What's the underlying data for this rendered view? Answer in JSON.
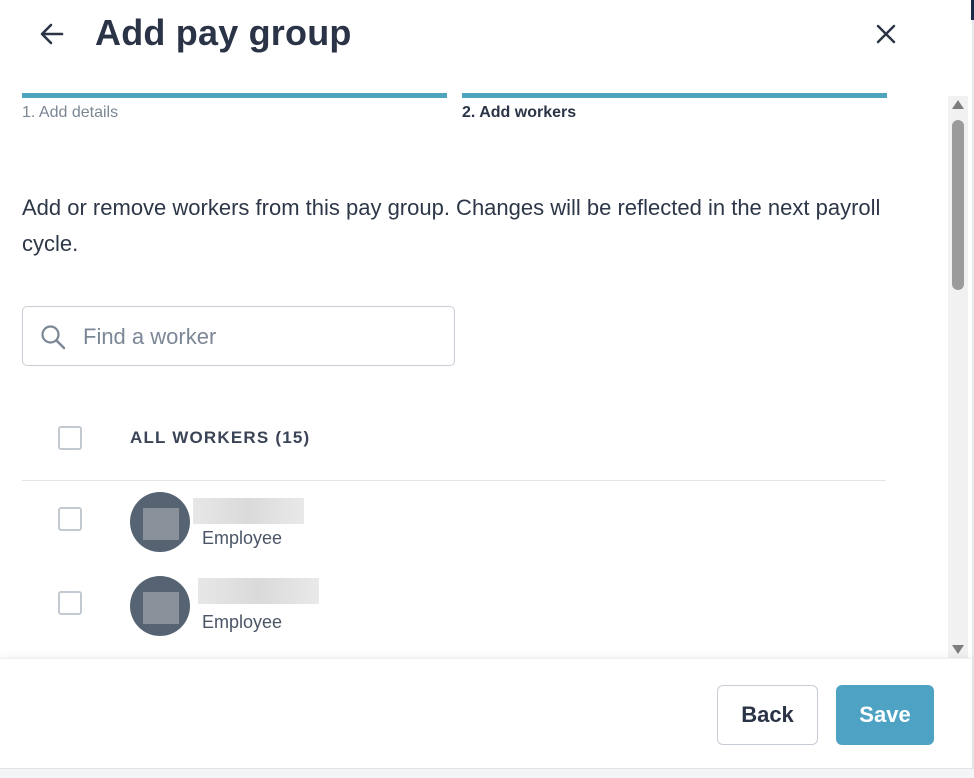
{
  "header": {
    "title": "Add pay group",
    "back_icon": "arrow-left-icon",
    "close_icon": "close-icon"
  },
  "steps": [
    {
      "label": "1. Add details",
      "complete": true
    },
    {
      "label": "2. Add workers",
      "active": true
    }
  ],
  "description": "Add or remove workers from this pay group. Changes will be reflected in the next payroll cycle.",
  "search": {
    "placeholder": "Find a worker",
    "value": "",
    "icon": "search-icon"
  },
  "list": {
    "select_all_label": "ALL WORKERS (15)",
    "workers": [
      {
        "role": "Employee",
        "checked": false
      },
      {
        "role": "Employee",
        "checked": false
      }
    ]
  },
  "footer": {
    "back_label": "Back",
    "save_label": "Save"
  },
  "colors": {
    "accent": "#4ea3bf",
    "save_button": "#4ea3c4",
    "title": "#2a3446",
    "avatar": "#566372"
  }
}
